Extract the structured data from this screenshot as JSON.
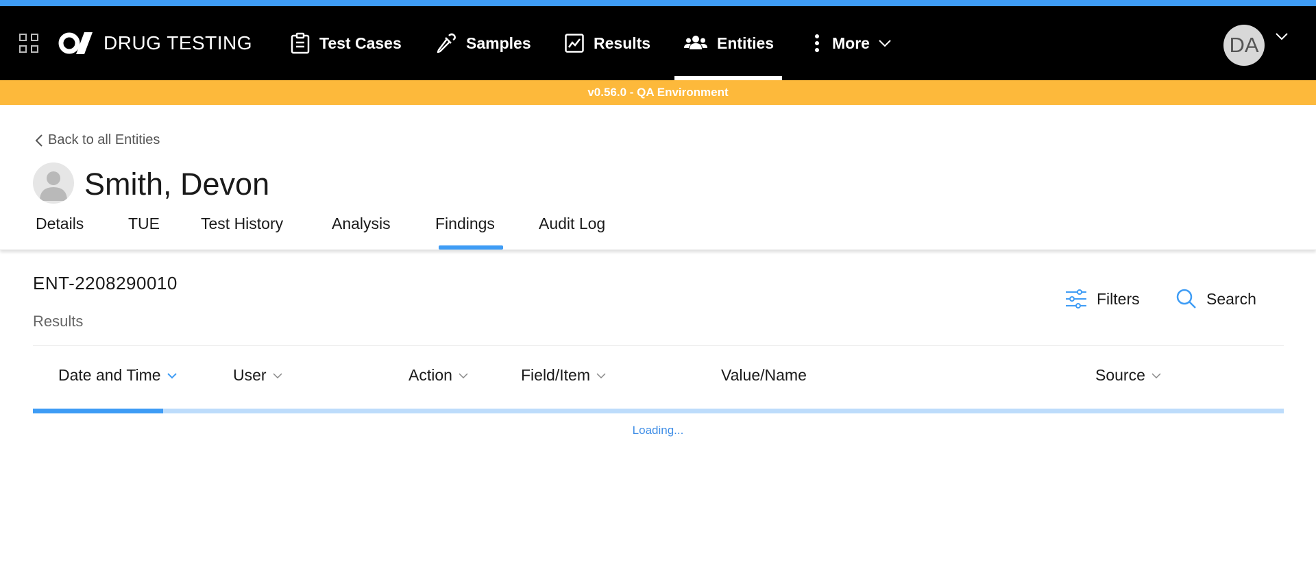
{
  "app": {
    "title": "DRUG TESTING"
  },
  "nav": {
    "items": [
      {
        "label": "Test Cases",
        "icon": "clipboard-icon"
      },
      {
        "label": "Samples",
        "icon": "pipette-icon"
      },
      {
        "label": "Results",
        "icon": "chart-line-icon"
      },
      {
        "label": "Entities",
        "icon": "users-icon",
        "active": true
      },
      {
        "label": "More",
        "icon": "kebab-icon"
      }
    ]
  },
  "user": {
    "initials": "DA"
  },
  "env_banner": "v0.56.0 - QA Environment",
  "header": {
    "back_label": "Back to all Entities",
    "entity_name": "Smith, Devon",
    "tabs": [
      {
        "label": "Details"
      },
      {
        "label": "TUE"
      },
      {
        "label": "Test History"
      },
      {
        "label": "Analysis"
      },
      {
        "label": "Findings",
        "active": true
      },
      {
        "label": "Audit Log"
      }
    ]
  },
  "content": {
    "entity_id": "ENT-2208290010",
    "results_label": "Results",
    "filters_label": "Filters",
    "search_label": "Search",
    "columns": [
      {
        "label": "Date and Time",
        "sorted": true
      },
      {
        "label": "User"
      },
      {
        "label": "Action"
      },
      {
        "label": "Field/Item"
      },
      {
        "label": "Value/Name"
      },
      {
        "label": "Source"
      }
    ],
    "progress": 0.104,
    "loading_text": "Loading..."
  },
  "colors": {
    "accent": "#3e9cf5",
    "env_banner": "#fdb93b",
    "navbar": "#000000"
  }
}
